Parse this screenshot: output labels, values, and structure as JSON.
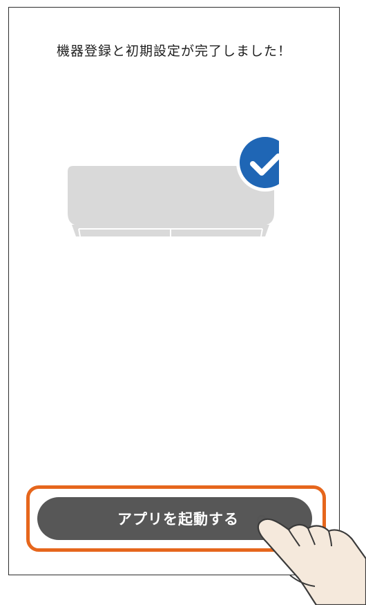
{
  "screen": {
    "title": "機器登録と初期設定が完了しました！"
  },
  "device": {
    "icon": "air-conditioner-icon",
    "status_icon": "checkmark-circle-icon",
    "status_color": "#1f66b5"
  },
  "actions": {
    "launch_label": "アプリを起動する"
  },
  "colors": {
    "button_bg": "#575757",
    "highlight": "#e6661c",
    "unit_gray": "#d9d9d9",
    "hand_skin": "#f5e9dc"
  }
}
